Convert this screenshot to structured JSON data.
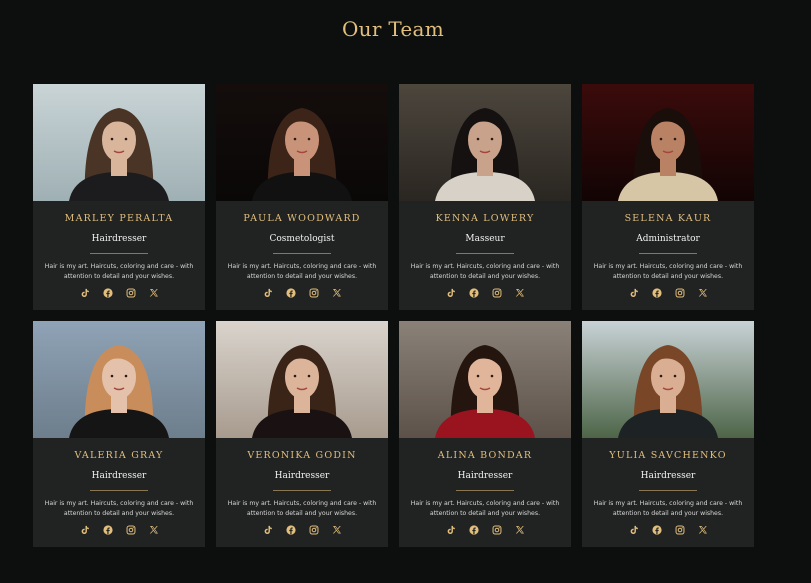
{
  "page": {
    "title": "Our Team"
  },
  "colors": {
    "background": "#0d0f0f",
    "card": "#212222",
    "accent": "#e2bf7c",
    "divider": "#8a7650",
    "text": "#f2f2f2"
  },
  "social_icons": [
    "tiktok-icon",
    "facebook-icon",
    "instagram-icon",
    "x-icon"
  ],
  "members": [
    {
      "name": "MARLEY PERALTA",
      "role": "Hairdresser",
      "description": "Hair is my art. Haircuts, coloring and care - with attention to detail and your wishes.",
      "photo": {
        "bg_top": "#c9d4d6",
        "bg_bottom": "#9fb0b4",
        "hair": "#4a3426",
        "skin": "#d9b59c",
        "shirt": "#1c1c1e"
      }
    },
    {
      "name": "PAULA WOODWARD",
      "role": "Cosmetologist",
      "description": "Hair is my art. Haircuts, coloring and care - with attention to detail and your wishes.",
      "photo": {
        "bg_top": "#140d0c",
        "bg_bottom": "#0a0707",
        "hair": "#3d2418",
        "skin": "#c99379",
        "shirt": "#111111"
      }
    },
    {
      "name": "KENNA LOWERY",
      "role": "Masseur",
      "description": "Hair is my art. Haircuts, coloring and care - with attention to detail and your wishes.",
      "photo": {
        "bg_top": "#4c463d",
        "bg_bottom": "#2a2621",
        "hair": "#141110",
        "skin": "#c8a28a",
        "shirt": "#d8d1c7"
      }
    },
    {
      "name": "SELENA KAUR",
      "role": "Administrator",
      "description": "Hair is my art. Haircuts, coloring and care - with attention to detail and your wishes.",
      "photo": {
        "bg_top": "#3b0b0b",
        "bg_bottom": "#120404",
        "hair": "#1a0e0b",
        "skin": "#b98264",
        "shirt": "#d6c6a6"
      }
    },
    {
      "name": "VALERIA GRAY",
      "role": "Hairdresser",
      "description": "Hair is my art. Haircuts, coloring and care - with attention to detail and your wishes.",
      "photo": {
        "bg_top": "#8fa3b6",
        "bg_bottom": "#6d7e8c",
        "hair": "#c98d5c",
        "skin": "#e4c1aa",
        "shirt": "#151515"
      }
    },
    {
      "name": "VERONIKA GODIN",
      "role": "Hairdresser",
      "description": "Hair is my art. Haircuts, coloring and care - with attention to detail and your wishes.",
      "photo": {
        "bg_top": "#d9d4cd",
        "bg_bottom": "#a89b8e",
        "hair": "#3a2418",
        "skin": "#dcb49a",
        "shirt": "#1a1212"
      }
    },
    {
      "name": "ALINA BONDAR",
      "role": "Hairdresser",
      "description": "Hair is my art. Haircuts, coloring and care - with attention to detail and your wishes.",
      "photo": {
        "bg_top": "#8a8178",
        "bg_bottom": "#5c5249",
        "hair": "#24160f",
        "skin": "#e1b59a",
        "shirt": "#9a1420"
      }
    },
    {
      "name": "YULIA SAVCHENKO",
      "role": "Hairdresser",
      "description": "Hair is my art. Haircuts, coloring and care - with attention to detail and your wishes.",
      "photo": {
        "bg_top": "#c8d2d6",
        "bg_bottom": "#4e6548",
        "hair": "#7a4628",
        "skin": "#d9ae93",
        "shirt": "#1d2224"
      }
    }
  ]
}
